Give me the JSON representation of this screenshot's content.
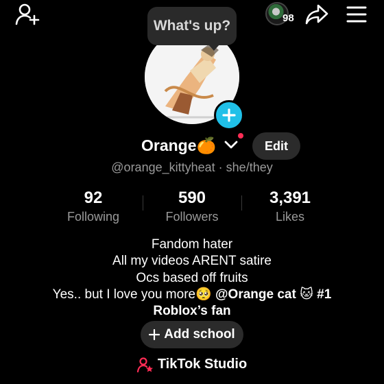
{
  "speech_bubble": {
    "text": "What's up?"
  },
  "header": {
    "badge_count": "98",
    "icons": [
      "add-friend-icon",
      "share-icon",
      "menu-icon"
    ]
  },
  "profile": {
    "display_name": "Orange🍊",
    "edit_label": "Edit",
    "handle": "@orange_kittyheat",
    "pronouns": "she/they"
  },
  "stats": {
    "following": {
      "value": "92",
      "label": "Following"
    },
    "followers": {
      "value": "590",
      "label": "Followers"
    },
    "likes": {
      "value": "3,391",
      "label": "Likes"
    }
  },
  "bio": {
    "line1": "Fandom hater",
    "line2": "All my videos ARENT satire",
    "line3": "Ocs based off fruits",
    "line4_text": "Yes.. but I love you more🥺",
    "line4_mention": "@Orange cat 🐱 #1",
    "line5": "Roblox’s fan"
  },
  "add_school_label": "Add school",
  "studio_label": "TikTok Studio",
  "colors": {
    "accent": "#20c0e8",
    "notification": "#ff2d55",
    "button_bg": "#2b2b2b",
    "studio_icon": "#fe2c55"
  }
}
